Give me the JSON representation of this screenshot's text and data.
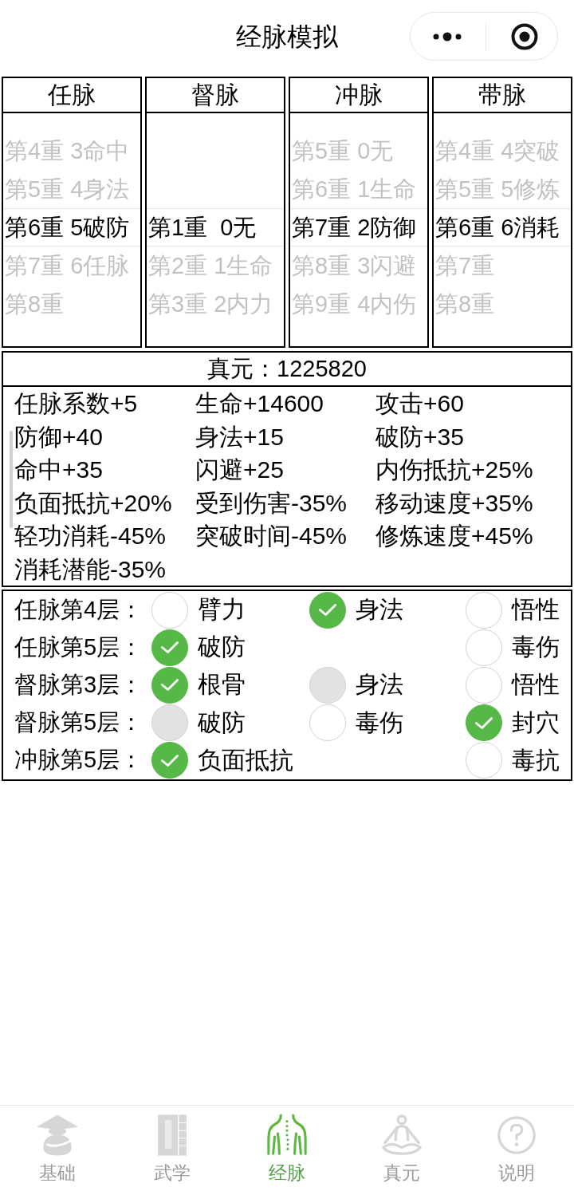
{
  "nav_bar": {
    "title": "经脉模拟"
  },
  "pickers": [
    {
      "title": "任脉",
      "options": [
        {
          "label": "第4重 3命中",
          "selected": false
        },
        {
          "label": "第5重 4身法",
          "selected": false
        },
        {
          "label": "第6重 5破防",
          "selected": true
        },
        {
          "label": "第7重 6任脉",
          "selected": false
        },
        {
          "label": "第8重",
          "selected": false
        }
      ]
    },
    {
      "title": "督脉",
      "options": [
        {
          "label": "第1重  0无",
          "selected": true
        },
        {
          "label": "第2重 1生命",
          "selected": false
        },
        {
          "label": "第3重 2内力",
          "selected": false
        }
      ]
    },
    {
      "title": "冲脉",
      "options": [
        {
          "label": "第5重 0无",
          "selected": false
        },
        {
          "label": "第6重 1生命",
          "selected": false
        },
        {
          "label": "第7重 2防御",
          "selected": true
        },
        {
          "label": "第8重 3闪避",
          "selected": false
        },
        {
          "label": "第9重 4内伤",
          "selected": false
        }
      ]
    },
    {
      "title": "带脉",
      "options": [
        {
          "label": "第4重 4突破",
          "selected": false
        },
        {
          "label": "第5重 5修炼",
          "selected": false
        },
        {
          "label": "第6重 6消耗",
          "selected": true
        },
        {
          "label": "第7重",
          "selected": false
        },
        {
          "label": "第8重",
          "selected": false
        }
      ]
    }
  ],
  "stats": {
    "header": "真元：1225820",
    "items": [
      "任脉系数+5",
      "生命+14600",
      "攻击+60",
      "防御+40",
      "身法+15",
      "破防+35",
      "命中+35",
      "闪避+25",
      "内伤抵抗+25%",
      "负面抵抗+20%",
      "受到伤害-35%",
      "移动速度+35%",
      "轻功消耗-45%",
      "突破时间-45%",
      "修炼速度+45%",
      "消耗潜能-35%"
    ]
  },
  "checks": [
    {
      "label": "任脉第4层：",
      "options": [
        {
          "label": "臂力",
          "checked": false,
          "disabled": false
        },
        {
          "label": "身法",
          "checked": true,
          "disabled": false
        },
        {
          "label": "悟性",
          "checked": false,
          "disabled": false
        }
      ]
    },
    {
      "label": "任脉第5层：",
      "options": [
        {
          "label": "破防",
          "checked": true,
          "disabled": false
        },
        {
          "label": "毒伤",
          "checked": false,
          "disabled": false
        }
      ]
    },
    {
      "label": "督脉第3层：",
      "options": [
        {
          "label": "根骨",
          "checked": true,
          "disabled": false
        },
        {
          "label": "身法",
          "checked": false,
          "disabled": true
        },
        {
          "label": "悟性",
          "checked": false,
          "disabled": false
        }
      ]
    },
    {
      "label": "督脉第5层：",
      "options": [
        {
          "label": "破防",
          "checked": false,
          "disabled": true
        },
        {
          "label": "毒伤",
          "checked": false,
          "disabled": false
        },
        {
          "label": "封穴",
          "checked": true,
          "disabled": false
        }
      ]
    },
    {
      "label": "冲脉第5层：",
      "options": [
        {
          "label": "负面抵抗",
          "checked": true,
          "disabled": false
        },
        {
          "label": "毒抗",
          "checked": false,
          "disabled": false
        }
      ]
    }
  ],
  "tab_bar": [
    {
      "label": "基础",
      "selected": false
    },
    {
      "label": "武学",
      "selected": false
    },
    {
      "label": "经脉",
      "selected": true
    },
    {
      "label": "真元",
      "selected": false
    },
    {
      "label": "说明",
      "selected": false
    }
  ]
}
